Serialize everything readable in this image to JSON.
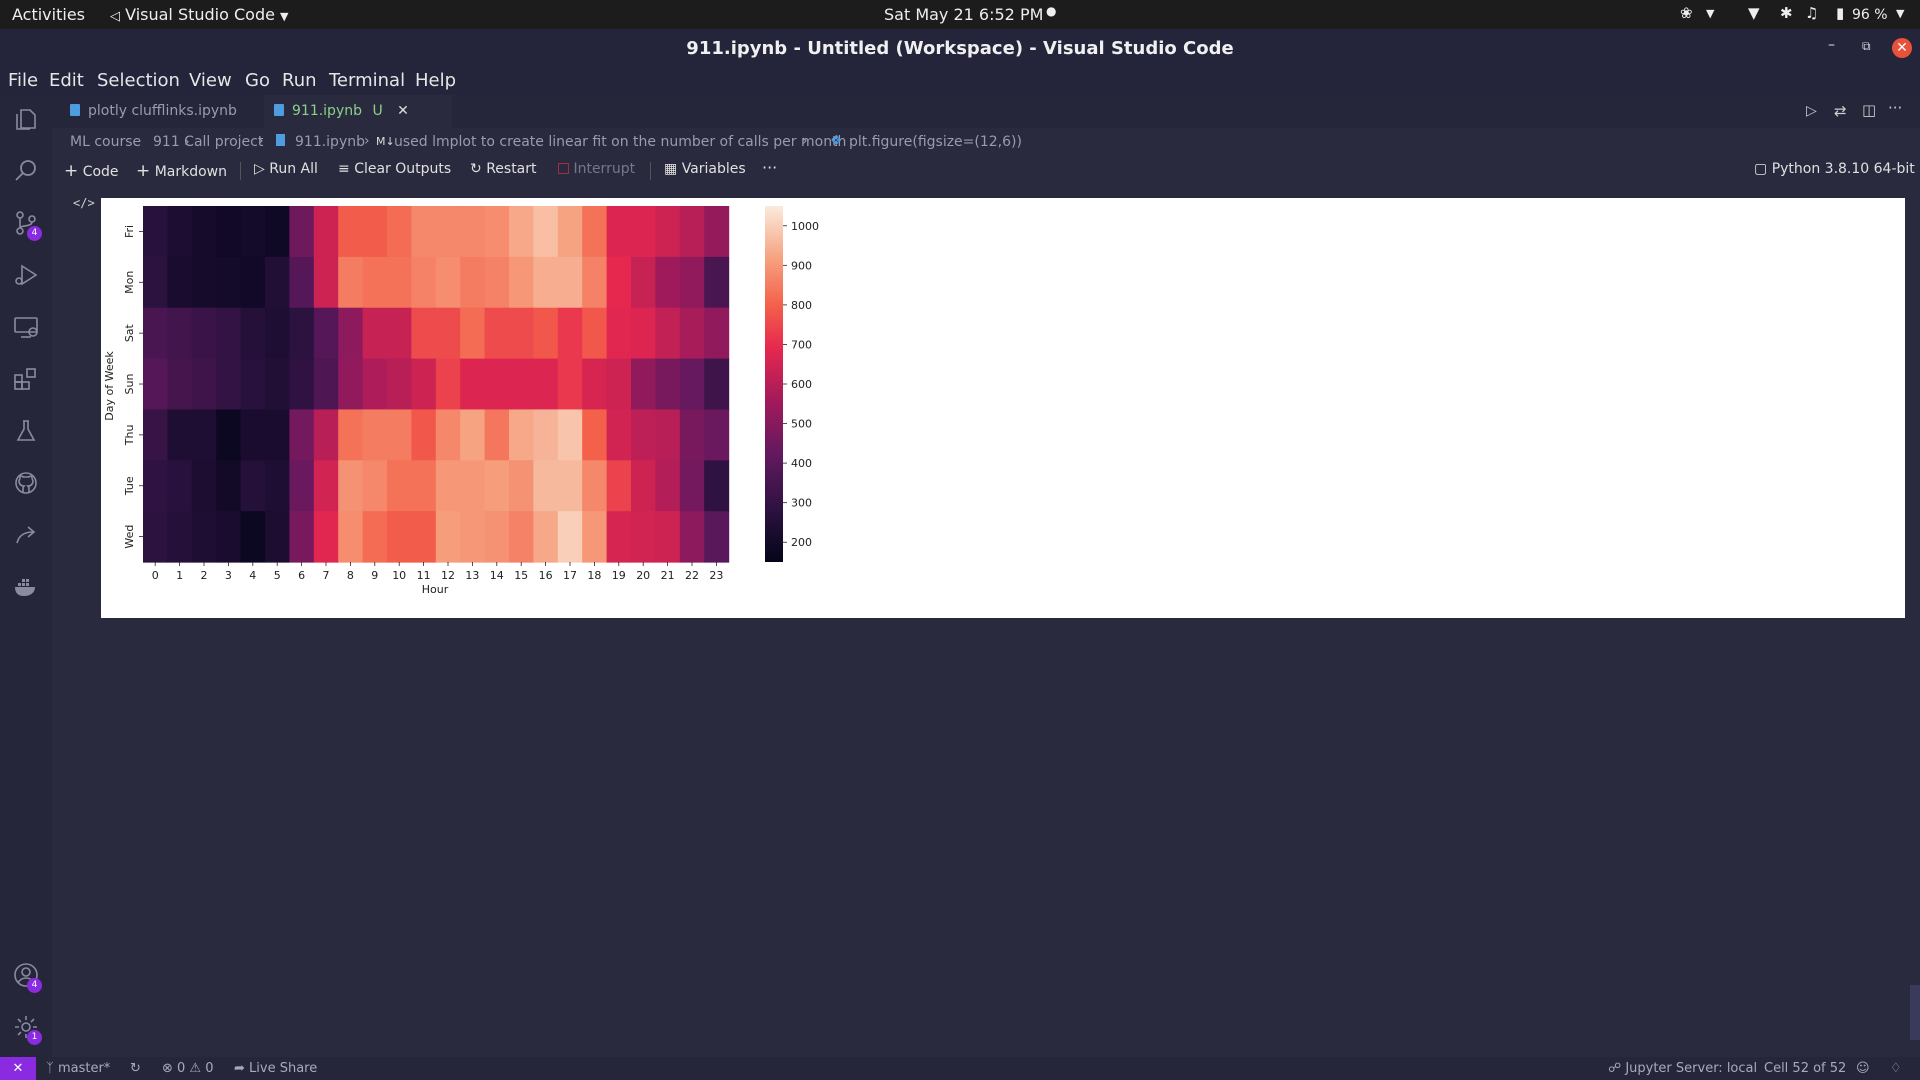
{
  "topbar": {
    "activities": "Activities",
    "app_menu": "Visual Studio Code",
    "clock": "Sat May 21   6:52 PM",
    "battery": "96 %"
  },
  "window": {
    "title": "911.ipynb - Untitled (Workspace) - Visual Studio Code"
  },
  "menu": [
    "File",
    "Edit",
    "Selection",
    "View",
    "Go",
    "Run",
    "Terminal",
    "Help"
  ],
  "activity_badges": {
    "source_control": "4",
    "accounts": "4",
    "settings": "1"
  },
  "tabs": [
    {
      "label": "plotly clufflinks.ipynb",
      "active": false
    },
    {
      "label": "911.ipynb",
      "status": "U",
      "active": true
    }
  ],
  "breadcrumb": {
    "folder1": "ML course",
    "folder2": "911 Call project",
    "file": "911.ipynb",
    "md_prefix": "M↓",
    "cell": "used lmplot to create linear fit on the number of calls per month",
    "symbol": "plt.figure(figsize=(12,6))"
  },
  "toolbar": {
    "code": "Code",
    "markdown": "Markdown",
    "run_all": "Run All",
    "clear_outputs": "Clear Outputs",
    "restart": "Restart",
    "interrupt": "Interrupt",
    "variables": "Variables",
    "more": "···",
    "kernel": "Python 3.8.10 64-bit"
  },
  "cell_toggle": "</>",
  "chart_data": {
    "type": "heatmap",
    "xlabel": "Hour",
    "ylabel": "Day of Week",
    "x": [
      0,
      1,
      2,
      3,
      4,
      5,
      6,
      7,
      8,
      9,
      10,
      11,
      12,
      13,
      14,
      15,
      16,
      17,
      18,
      19,
      20,
      21,
      22,
      23
    ],
    "y": [
      "Fri",
      "Mon",
      "Sat",
      "Sun",
      "Thu",
      "Tue",
      "Wed"
    ],
    "colorbar_ticks": [
      200,
      300,
      400,
      500,
      600,
      700,
      800,
      900,
      1000
    ],
    "vmin": 150,
    "vmax": 1050,
    "values": [
      [
        270,
        235,
        210,
        195,
        205,
        190,
        450,
        640,
        790,
        790,
        820,
        870,
        870,
        870,
        880,
        930,
        970,
        920,
        830,
        670,
        670,
        640,
        600,
        530
      ],
      [
        280,
        225,
        215,
        205,
        195,
        250,
        390,
        640,
        850,
        830,
        830,
        860,
        880,
        850,
        860,
        900,
        940,
        940,
        860,
        690,
        630,
        550,
        520,
        360
      ],
      [
        360,
        340,
        320,
        300,
        260,
        240,
        280,
        390,
        510,
        630,
        630,
        760,
        760,
        820,
        760,
        760,
        780,
        720,
        780,
        680,
        670,
        620,
        570,
        520
      ],
      [
        390,
        350,
        330,
        300,
        270,
        250,
        290,
        370,
        520,
        580,
        600,
        640,
        740,
        670,
        670,
        670,
        670,
        720,
        660,
        640,
        520,
        470,
        430,
        330
      ],
      [
        310,
        240,
        240,
        180,
        220,
        220,
        460,
        600,
        830,
        850,
        850,
        780,
        870,
        920,
        840,
        930,
        950,
        980,
        800,
        650,
        610,
        600,
        470,
        440
      ],
      [
        290,
        270,
        230,
        200,
        260,
        240,
        440,
        650,
        890,
        870,
        830,
        830,
        900,
        900,
        910,
        890,
        960,
        960,
        870,
        740,
        640,
        590,
        460,
        290
      ],
      [
        280,
        260,
        240,
        220,
        180,
        230,
        470,
        680,
        880,
        820,
        790,
        790,
        910,
        900,
        890,
        860,
        930,
        1000,
        900,
        660,
        650,
        640,
        510,
        400
      ]
    ]
  },
  "status": {
    "remote": "✕",
    "branch": "master*",
    "problems": "⊗ 0 ⚠ 0",
    "liveshare": "Live Share",
    "jupyter": "Jupyter Server: local",
    "cell": "Cell 52 of 52"
  }
}
